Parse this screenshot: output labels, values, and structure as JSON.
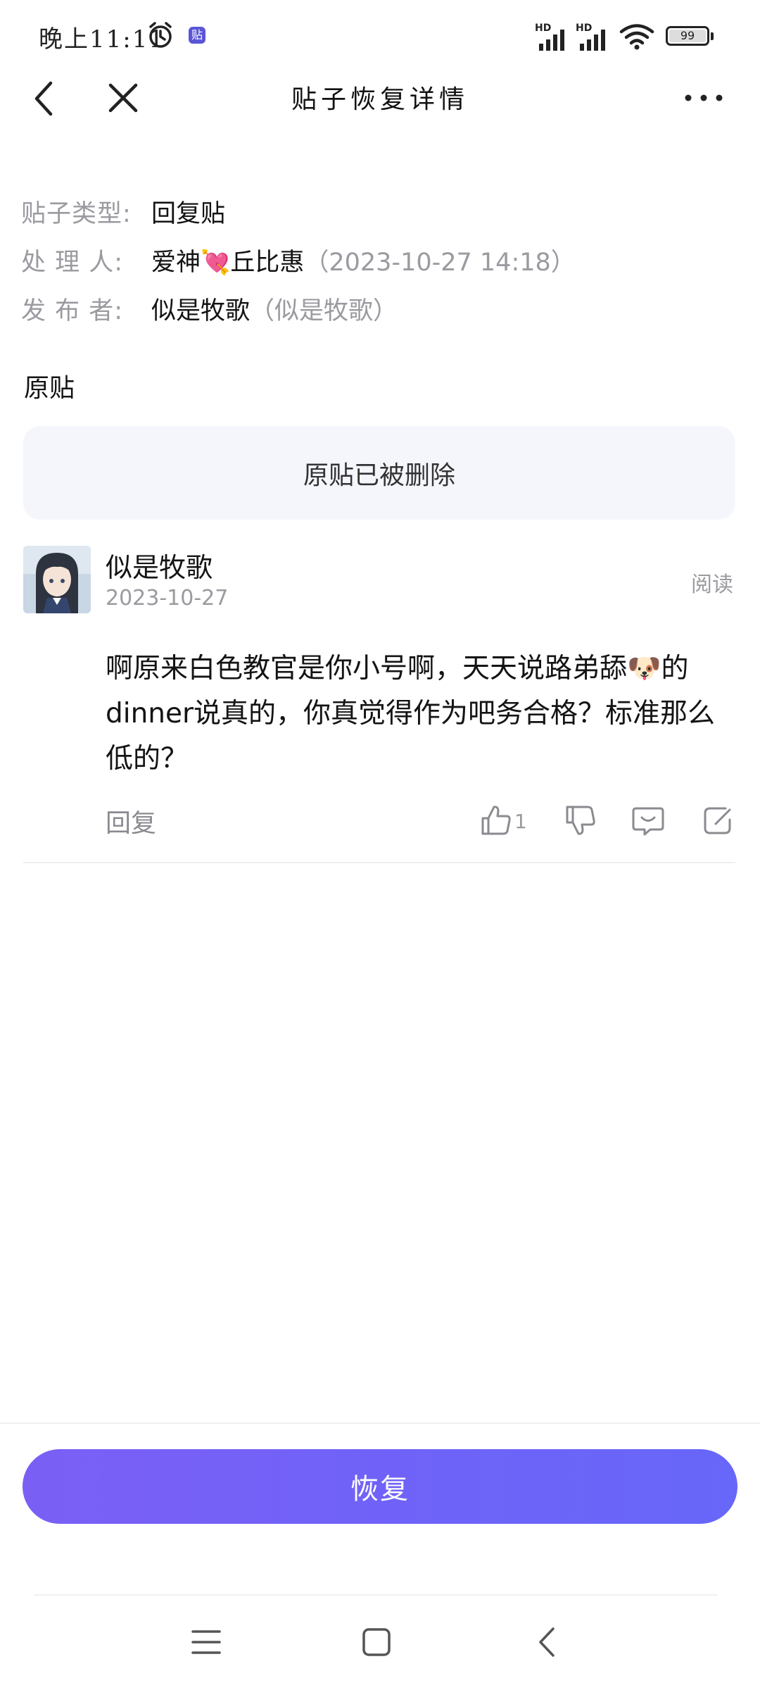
{
  "status_bar": {
    "time": "晚上11:11",
    "network_1": "HD",
    "network_2": "HD",
    "battery": "99"
  },
  "header": {
    "title": "贴子恢复详情"
  },
  "info": {
    "type_label": "贴子类型:",
    "type_value": "回复贴",
    "handler_label": "处 理 人:",
    "handler_name_prefix": "爱神",
    "handler_emoji": "💘",
    "handler_name_suffix": "丘比惠",
    "handler_time": "（2023-10-27 14:18）",
    "publisher_label": "发 布 者:",
    "publisher_name": "似是牧歌",
    "publisher_id": "（似是牧歌）"
  },
  "original": {
    "section_title": "原贴",
    "deleted_text": "原贴已被删除"
  },
  "post": {
    "author": "似是牧歌",
    "date": "2023-10-27",
    "read_label": "阅读",
    "content": "啊原来白色教官是你小号啊，天天说路弟舔🐶的dinner说真的，你真觉得作为吧务合格？标准那么低的？",
    "reply_label": "回复",
    "like_count": "1"
  },
  "footer": {
    "restore_label": "恢复"
  },
  "icons": {
    "back": "back-icon",
    "close": "close-icon",
    "more": "more-icon",
    "like": "thumbs-up-icon",
    "dislike": "thumbs-down-icon",
    "comment": "comment-icon",
    "share": "share-icon"
  },
  "colors": {
    "accent": "#6e63f8",
    "muted_text": "#9a9aa0",
    "deleted_bg": "#f5f6fc"
  }
}
